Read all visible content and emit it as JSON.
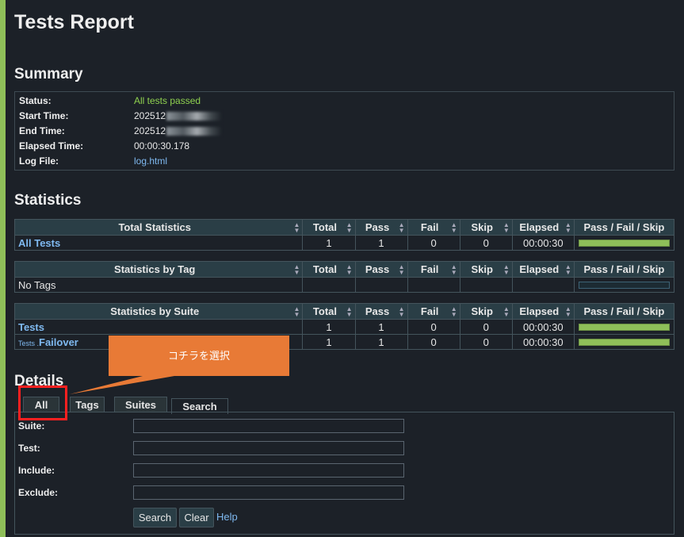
{
  "page": {
    "title": "Tests Report"
  },
  "summary": {
    "heading": "Summary",
    "rows": [
      {
        "label": "Status:",
        "value": "All tests passed"
      },
      {
        "label": "Start Time:",
        "value": "202512"
      },
      {
        "label": "End Time:",
        "value": "202512"
      },
      {
        "label": "Elapsed Time:",
        "value": "00:00:30.178"
      },
      {
        "label": "Log File:",
        "value": "log.html"
      }
    ]
  },
  "statistics": {
    "heading": "Statistics",
    "columns": [
      "Total",
      "Pass",
      "Fail",
      "Skip",
      "Elapsed",
      "Pass / Fail / Skip"
    ],
    "total": {
      "header": "Total Statistics",
      "rows": [
        {
          "name": "All Tests",
          "total": "1",
          "pass": "1",
          "fail": "0",
          "skip": "0",
          "elapsed": "00:00:30",
          "pass_ratio": 1.0
        }
      ]
    },
    "tag": {
      "header": "Statistics by Tag",
      "rows": [
        {
          "name": "No Tags",
          "total": "",
          "pass": "",
          "fail": "",
          "skip": "",
          "elapsed": "",
          "pass_ratio": 0
        }
      ]
    },
    "suite": {
      "header": "Statistics by Suite",
      "rows": [
        {
          "name": "Tests",
          "prefix": "",
          "total": "1",
          "pass": "1",
          "fail": "0",
          "skip": "0",
          "elapsed": "00:00:30",
          "pass_ratio": 1.0
        },
        {
          "name": "Failover",
          "prefix": "Tests .",
          "total": "1",
          "pass": "1",
          "fail": "0",
          "skip": "0",
          "elapsed": "00:00:30",
          "pass_ratio": 1.0
        }
      ]
    }
  },
  "details": {
    "heading": "Details",
    "tabs": [
      "All",
      "Tags",
      "Suites",
      "Search"
    ],
    "fields": [
      {
        "label": "Suite:",
        "value": ""
      },
      {
        "label": "Test:",
        "value": ""
      },
      {
        "label": "Include:",
        "value": ""
      },
      {
        "label": "Exclude:",
        "value": ""
      }
    ],
    "search_button": "Search",
    "clear_button": "Clear",
    "help_link": "Help"
  },
  "annotation": {
    "callout_text": "コチラを選択"
  },
  "colors": {
    "accent_bar": "#8fbf59",
    "pass_bar": "#8fbf59",
    "link": "#7fb9f0",
    "annotation_orange": "#e87a36",
    "annotation_red": "#ff2020"
  }
}
